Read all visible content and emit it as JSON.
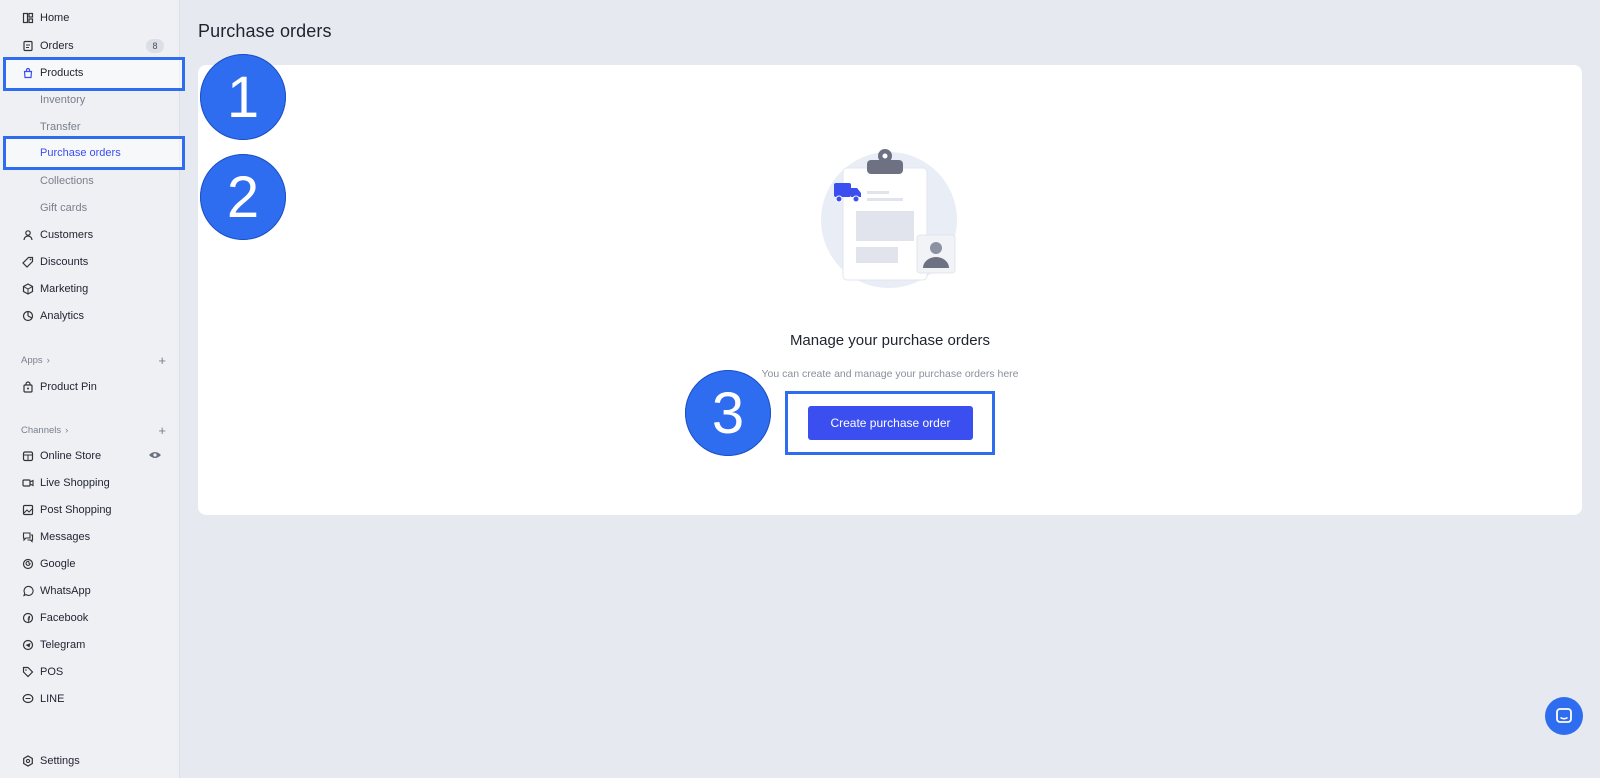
{
  "sidebar": {
    "items": [
      {
        "label": "Home"
      },
      {
        "label": "Orders",
        "badge": "8"
      },
      {
        "label": "Products"
      },
      {
        "label": "Inventory"
      },
      {
        "label": "Transfer"
      },
      {
        "label": "Purchase orders"
      },
      {
        "label": "Collections"
      },
      {
        "label": "Gift cards"
      },
      {
        "label": "Customers"
      },
      {
        "label": "Discounts"
      },
      {
        "label": "Marketing"
      },
      {
        "label": "Analytics"
      }
    ],
    "apps_heading": "Apps",
    "apps": [
      {
        "label": "Product Pin"
      }
    ],
    "channels_heading": "Channels",
    "channels": [
      {
        "label": "Online Store"
      },
      {
        "label": "Live Shopping"
      },
      {
        "label": "Post Shopping"
      },
      {
        "label": "Messages"
      },
      {
        "label": "Google"
      },
      {
        "label": "WhatsApp"
      },
      {
        "label": "Facebook"
      },
      {
        "label": "Telegram"
      },
      {
        "label": "POS"
      },
      {
        "label": "LINE"
      }
    ],
    "settings_label": "Settings"
  },
  "main": {
    "page_title": "Purchase orders",
    "empty_state": {
      "title": "Manage your purchase orders",
      "subtitle": "You can create and manage your purchase orders here",
      "cta_label": "Create purchase order"
    }
  },
  "steps": [
    "1",
    "2",
    "3"
  ],
  "colors": {
    "accent": "#3b4ef0",
    "annotation": "#2f6df0",
    "background": "#e6e9ef"
  }
}
